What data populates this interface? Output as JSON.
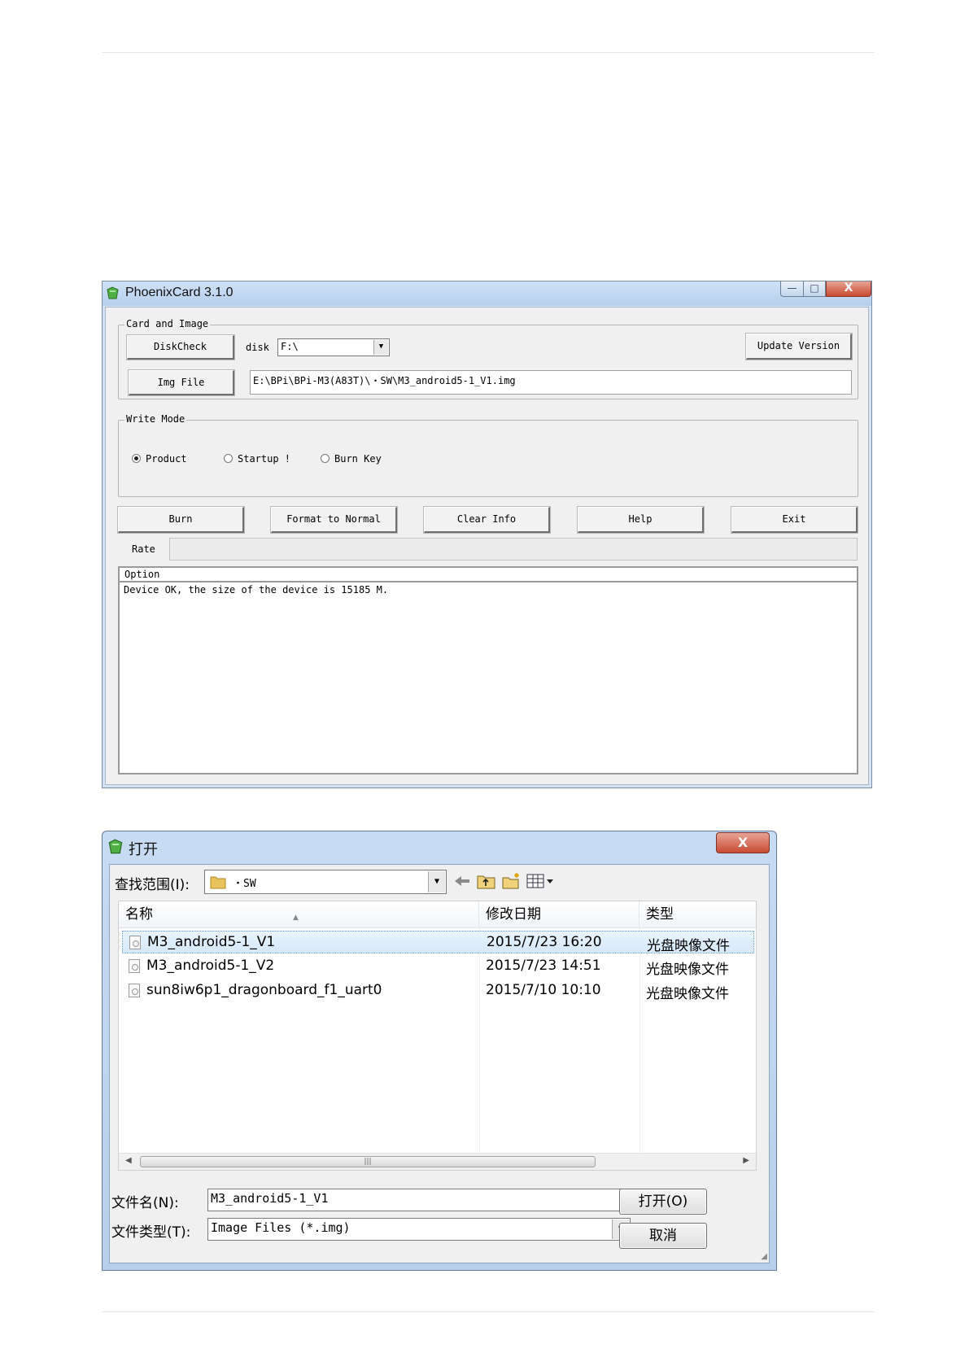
{
  "phoenix": {
    "title": "PhoenixCard 3.1.0",
    "controls": {
      "minimize": "—",
      "maximize": "□",
      "close": "X"
    },
    "card_group": {
      "legend": "Card and Image",
      "diskcheck_label": "DiskCheck",
      "disk_label": "disk",
      "disk_value": "F:\\",
      "update_label": "Update Version",
      "imgfile_label": "Img File",
      "img_path": "E:\\BPi\\BPi-M3(A83T)\\・SW\\M3_android5-1_V1.img"
    },
    "write_mode": {
      "legend": "Write Mode",
      "options": [
        {
          "label": "Product",
          "selected": true
        },
        {
          "label": "Startup !",
          "selected": false
        },
        {
          "label": "Burn Key",
          "selected": false
        }
      ]
    },
    "actions": [
      "Burn",
      "Format to Normal",
      "Clear Info",
      "Help",
      "Exit"
    ],
    "rate_label": "Rate",
    "option_header": "Option",
    "option_message": "Device OK, the size of the device is 15185 M."
  },
  "open_dialog": {
    "title": "打开",
    "close": "X",
    "lookin_label": "查找范围(I):",
    "lookin_value": "・SW",
    "columns": [
      "名称",
      "修改日期",
      "类型"
    ],
    "files": [
      {
        "name": "M3_android5-1_V1",
        "date": "2015/7/23 16:20",
        "type": "光盘映像文件",
        "selected": true
      },
      {
        "name": "M3_android5-1_V2",
        "date": "2015/7/23 14:51",
        "type": "光盘映像文件",
        "selected": false
      },
      {
        "name": "sun8iw6p1_dragonboard_f1_uart0",
        "date": "2015/7/10 10:10",
        "type": "光盘映像文件",
        "selected": false
      }
    ],
    "filename_label": "文件名(N):",
    "filename_value": "M3_android5-1_V1",
    "filetype_label": "文件类型(T):",
    "filetype_value": "Image Files (*.img)",
    "open_button": "打开(O)",
    "cancel_button": "取消"
  },
  "icons": [
    "phoenix-app-icon",
    "folder-icon",
    "back-arrow-icon",
    "up-folder-icon",
    "new-folder-icon",
    "view-menu-icon",
    "file-icon"
  ]
}
